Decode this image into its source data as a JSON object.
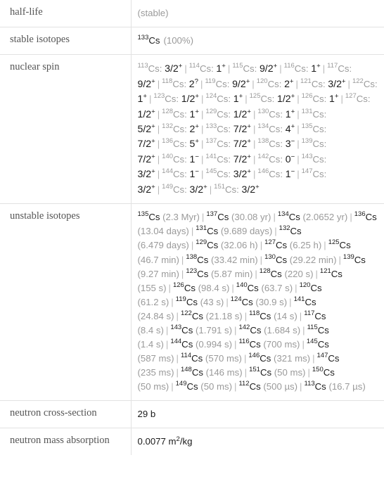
{
  "table": {
    "rows": [
      {
        "key": "half_life",
        "label": "half-life"
      },
      {
        "key": "stable",
        "label": "stable isotopes"
      },
      {
        "key": "spin",
        "label": "nuclear spin"
      },
      {
        "key": "unstable",
        "label": "unstable isotopes"
      },
      {
        "key": "xsection",
        "label": "neutron cross-section"
      },
      {
        "key": "absorption",
        "label": "neutron mass absorption"
      }
    ]
  },
  "half_life": {
    "value": "(stable)"
  },
  "stable_isotopes": {
    "items": [
      {
        "mass": "133",
        "element": "Cs",
        "abundance": "(100%)"
      }
    ]
  },
  "nuclear_spin": {
    "separator": "|",
    "items": [
      {
        "mass": "113",
        "element": "Cs",
        "spin": "3/2",
        "parity": "+"
      },
      {
        "mass": "114",
        "element": "Cs",
        "spin": "1",
        "parity": "+"
      },
      {
        "mass": "115",
        "element": "Cs",
        "spin": "9/2",
        "parity": "+"
      },
      {
        "mass": "116",
        "element": "Cs",
        "spin": "1",
        "parity": "+"
      },
      {
        "mass": "117",
        "element": "Cs",
        "spin": "9/2",
        "parity": "+"
      },
      {
        "mass": "118",
        "element": "Cs",
        "spin": "2",
        "parity": "?"
      },
      {
        "mass": "119",
        "element": "Cs",
        "spin": "9/2",
        "parity": "+"
      },
      {
        "mass": "120",
        "element": "Cs",
        "spin": "2",
        "parity": "+"
      },
      {
        "mass": "121",
        "element": "Cs",
        "spin": "3/2",
        "parity": "+"
      },
      {
        "mass": "122",
        "element": "Cs",
        "spin": "1",
        "parity": "+"
      },
      {
        "mass": "123",
        "element": "Cs",
        "spin": "1/2",
        "parity": "+"
      },
      {
        "mass": "124",
        "element": "Cs",
        "spin": "1",
        "parity": "+"
      },
      {
        "mass": "125",
        "element": "Cs",
        "spin": "1/2",
        "parity": "+"
      },
      {
        "mass": "126",
        "element": "Cs",
        "spin": "1",
        "parity": "+"
      },
      {
        "mass": "127",
        "element": "Cs",
        "spin": "1/2",
        "parity": "+"
      },
      {
        "mass": "128",
        "element": "Cs",
        "spin": "1",
        "parity": "+"
      },
      {
        "mass": "129",
        "element": "Cs",
        "spin": "1/2",
        "parity": "+"
      },
      {
        "mass": "130",
        "element": "Cs",
        "spin": "1",
        "parity": "+"
      },
      {
        "mass": "131",
        "element": "Cs",
        "spin": "5/2",
        "parity": "+"
      },
      {
        "mass": "132",
        "element": "Cs",
        "spin": "2",
        "parity": "+"
      },
      {
        "mass": "133",
        "element": "Cs",
        "spin": "7/2",
        "parity": "+"
      },
      {
        "mass": "134",
        "element": "Cs",
        "spin": "4",
        "parity": "+"
      },
      {
        "mass": "135",
        "element": "Cs",
        "spin": "7/2",
        "parity": "+"
      },
      {
        "mass": "136",
        "element": "Cs",
        "spin": "5",
        "parity": "+"
      },
      {
        "mass": "137",
        "element": "Cs",
        "spin": "7/2",
        "parity": "+"
      },
      {
        "mass": "138",
        "element": "Cs",
        "spin": "3",
        "parity": "-"
      },
      {
        "mass": "139",
        "element": "Cs",
        "spin": "7/2",
        "parity": "+"
      },
      {
        "mass": "140",
        "element": "Cs",
        "spin": "1",
        "parity": "-"
      },
      {
        "mass": "141",
        "element": "Cs",
        "spin": "7/2",
        "parity": "+"
      },
      {
        "mass": "142",
        "element": "Cs",
        "spin": "0",
        "parity": "-"
      },
      {
        "mass": "143",
        "element": "Cs",
        "spin": "3/2",
        "parity": "+"
      },
      {
        "mass": "144",
        "element": "Cs",
        "spin": "1",
        "parity": "-"
      },
      {
        "mass": "145",
        "element": "Cs",
        "spin": "3/2",
        "parity": "+"
      },
      {
        "mass": "146",
        "element": "Cs",
        "spin": "1",
        "parity": "-"
      },
      {
        "mass": "147",
        "element": "Cs",
        "spin": "3/2",
        "parity": "+"
      },
      {
        "mass": "149",
        "element": "Cs",
        "spin": "3/2",
        "parity": "+"
      },
      {
        "mass": "151",
        "element": "Cs",
        "spin": "3/2",
        "parity": "+"
      }
    ]
  },
  "unstable_isotopes": {
    "separator": "|",
    "items": [
      {
        "mass": "135",
        "element": "Cs",
        "half_life": "(2.3 Myr)"
      },
      {
        "mass": "137",
        "element": "Cs",
        "half_life": "(30.08 yr)"
      },
      {
        "mass": "134",
        "element": "Cs",
        "half_life": "(2.0652 yr)"
      },
      {
        "mass": "136",
        "element": "Cs",
        "half_life": "(13.04 days)"
      },
      {
        "mass": "131",
        "element": "Cs",
        "half_life": "(9.689 days)"
      },
      {
        "mass": "132",
        "element": "Cs",
        "half_life": "(6.479 days)"
      },
      {
        "mass": "129",
        "element": "Cs",
        "half_life": "(32.06 h)"
      },
      {
        "mass": "127",
        "element": "Cs",
        "half_life": "(6.25 h)"
      },
      {
        "mass": "125",
        "element": "Cs",
        "half_life": "(46.7 min)"
      },
      {
        "mass": "138",
        "element": "Cs",
        "half_life": "(33.42 min)"
      },
      {
        "mass": "130",
        "element": "Cs",
        "half_life": "(29.22 min)"
      },
      {
        "mass": "139",
        "element": "Cs",
        "half_life": "(9.27 min)"
      },
      {
        "mass": "123",
        "element": "Cs",
        "half_life": "(5.87 min)"
      },
      {
        "mass": "128",
        "element": "Cs",
        "half_life": "(220 s)"
      },
      {
        "mass": "121",
        "element": "Cs",
        "half_life": "(155 s)"
      },
      {
        "mass": "126",
        "element": "Cs",
        "half_life": "(98.4 s)"
      },
      {
        "mass": "140",
        "element": "Cs",
        "half_life": "(63.7 s)"
      },
      {
        "mass": "120",
        "element": "Cs",
        "half_life": "(61.2 s)"
      },
      {
        "mass": "119",
        "element": "Cs",
        "half_life": "(43 s)"
      },
      {
        "mass": "124",
        "element": "Cs",
        "half_life": "(30.9 s)"
      },
      {
        "mass": "141",
        "element": "Cs",
        "half_life": "(24.84 s)"
      },
      {
        "mass": "122",
        "element": "Cs",
        "half_life": "(21.18 s)"
      },
      {
        "mass": "118",
        "element": "Cs",
        "half_life": "(14 s)"
      },
      {
        "mass": "117",
        "element": "Cs",
        "half_life": "(8.4 s)"
      },
      {
        "mass": "143",
        "element": "Cs",
        "half_life": "(1.791 s)"
      },
      {
        "mass": "142",
        "element": "Cs",
        "half_life": "(1.684 s)"
      },
      {
        "mass": "115",
        "element": "Cs",
        "half_life": "(1.4 s)"
      },
      {
        "mass": "144",
        "element": "Cs",
        "half_life": "(0.994 s)"
      },
      {
        "mass": "116",
        "element": "Cs",
        "half_life": "(700 ms)"
      },
      {
        "mass": "145",
        "element": "Cs",
        "half_life": "(587 ms)"
      },
      {
        "mass": "114",
        "element": "Cs",
        "half_life": "(570 ms)"
      },
      {
        "mass": "146",
        "element": "Cs",
        "half_life": "(321 ms)"
      },
      {
        "mass": "147",
        "element": "Cs",
        "half_life": "(235 ms)"
      },
      {
        "mass": "148",
        "element": "Cs",
        "half_life": "(146 ms)"
      },
      {
        "mass": "151",
        "element": "Cs",
        "half_life": "(50 ms)"
      },
      {
        "mass": "150",
        "element": "Cs",
        "half_life": "(50 ms)"
      },
      {
        "mass": "149",
        "element": "Cs",
        "half_life": "(50 ms)"
      },
      {
        "mass": "112",
        "element": "Cs",
        "half_life": "(500 µs)"
      },
      {
        "mass": "113",
        "element": "Cs",
        "half_life": "(16.7 µs)"
      }
    ]
  },
  "neutron_cross_section": {
    "value": "29 b"
  },
  "neutron_mass_absorption": {
    "value_number": "0.0077",
    "unit_base": "m",
    "unit_exponent": "2",
    "unit_tail": "/kg"
  },
  "colors": {
    "border": "#e2e2e2",
    "label_text": "#555555",
    "value_text": "#1a1a1a",
    "muted_text": "#9a9a9a",
    "separator": "#b8b8b8"
  }
}
